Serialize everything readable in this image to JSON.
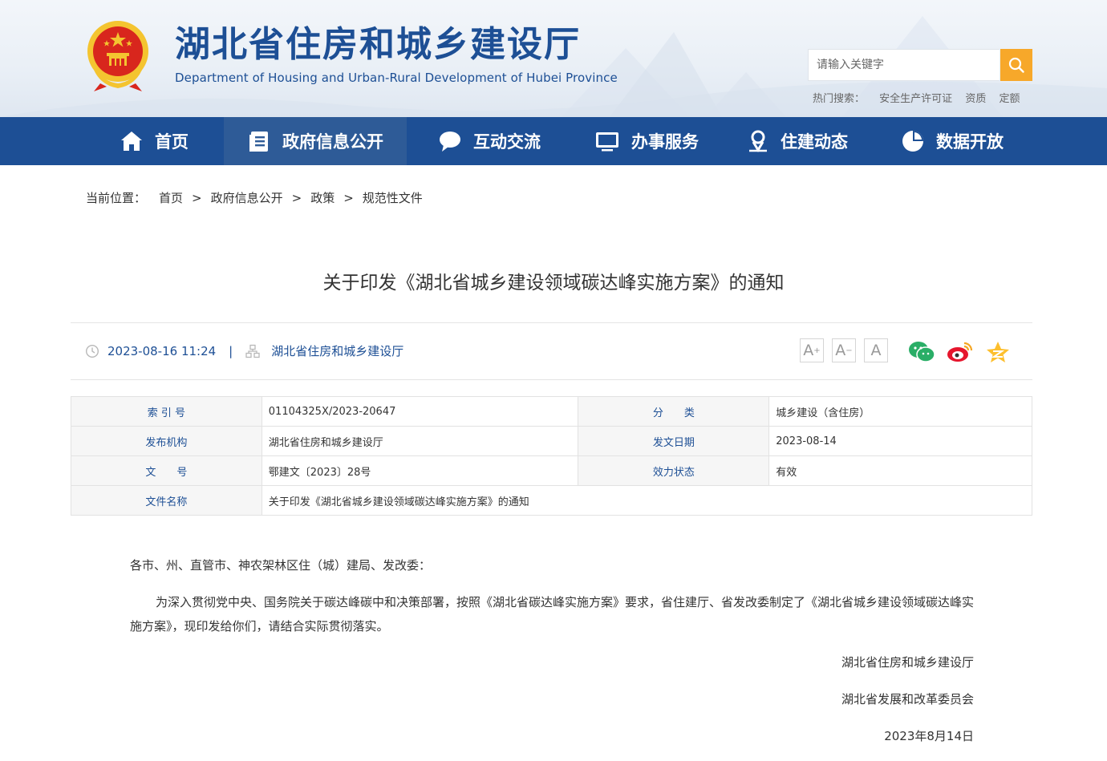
{
  "header": {
    "title": "湖北省住房和城乡建设厅",
    "subtitle": "Department of Housing and Urban-Rural Development of Hubei Province",
    "search_placeholder": "请输入关键字",
    "hot_label": "热门搜索：",
    "hot_items": [
      "安全生产许可证",
      "资质",
      "定额"
    ]
  },
  "nav": [
    {
      "label": "首页",
      "icon": "home-icon"
    },
    {
      "label": "政府信息公开",
      "icon": "document-list-icon"
    },
    {
      "label": "互动交流",
      "icon": "chat-bubble-icon"
    },
    {
      "label": "办事服务",
      "icon": "monitor-icon"
    },
    {
      "label": "住建动态",
      "icon": "person-pin-icon"
    },
    {
      "label": "数据开放",
      "icon": "pie-chart-icon"
    }
  ],
  "breadcrumb": {
    "label": "当前位置：",
    "items": [
      "首页",
      "政府信息公开",
      "政策",
      "规范性文件"
    ],
    "sep": ">"
  },
  "article": {
    "title": "关于印发《湖北省城乡建设领域碳达峰实施方案》的通知",
    "datetime": "2023-08-16 11:24",
    "pipe": "|",
    "source": "湖北省住房和城乡建设厅",
    "font_sizes": [
      "A",
      "A",
      "A"
    ],
    "share_icons": [
      "wechat-icon",
      "weibo-icon",
      "qzone-icon"
    ]
  },
  "info_table": {
    "rows": [
      {
        "k1": "索 引 号",
        "v1": "01104325X/2023-20647",
        "k2": "分　　类",
        "v2": "城乡建设（含住房）"
      },
      {
        "k1": "发布机构",
        "v1": "湖北省住房和城乡建设厅",
        "k2": "发文日期",
        "v2": "2023-08-14"
      },
      {
        "k1": "文　　号",
        "v1": "鄂建文〔2023〕28号",
        "k2": "效力状态",
        "v2": "有效"
      }
    ],
    "name_label": "文件名称",
    "name_value": "关于印发《湖北省城乡建设领域碳达峰实施方案》的通知"
  },
  "body": {
    "salutation": "各市、州、直管市、神农架林区住（城）建局、发改委：",
    "paragraph": "为深入贯彻党中央、国务院关于碳达峰碳中和决策部署，按照《湖北省碳达峰实施方案》要求，省住建厅、省发改委制定了《湖北省城乡建设领域碳达峰实施方案》，现印发给你们，请结合实际贯彻落实。",
    "signer1": "湖北省住房和城乡建设厅",
    "signer2": "湖北省发展和改革委员会",
    "date": "2023年8月14日"
  },
  "colors": {
    "primary": "#1d4f95",
    "accent": "#f7a82a",
    "emblem_red": "#d8261d",
    "emblem_gold": "#f4c430"
  }
}
